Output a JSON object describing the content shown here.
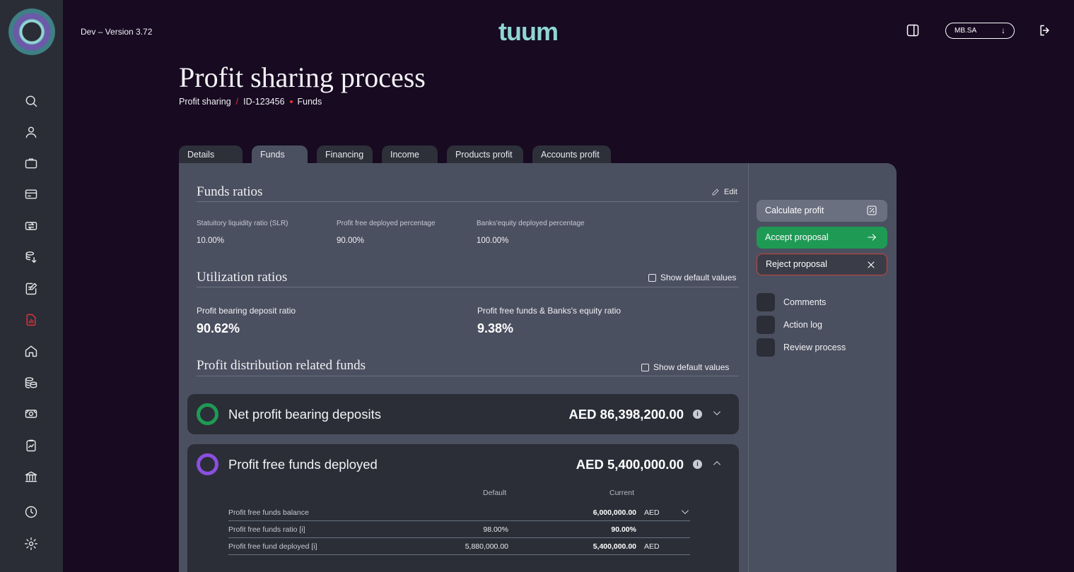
{
  "header": {
    "version": "Dev – Version 3.72",
    "brand": "tuum",
    "org_select": "MB.SA",
    "org_arrow": "↓"
  },
  "sidebar": {
    "items": [
      {
        "icon": "search-icon"
      },
      {
        "icon": "user-icon"
      },
      {
        "icon": "briefcase-icon"
      },
      {
        "icon": "card-icon"
      },
      {
        "icon": "transfer-icon"
      },
      {
        "icon": "coins-transfer-icon"
      },
      {
        "icon": "document-edit-icon"
      },
      {
        "icon": "report-chart-icon",
        "active": true
      },
      {
        "icon": "home-icon"
      },
      {
        "icon": "coins-stack-icon"
      },
      {
        "icon": "cash-icon"
      },
      {
        "icon": "clipboard-chart-icon"
      },
      {
        "icon": "bank-icon"
      },
      {
        "icon": "clock-icon"
      },
      {
        "icon": "settings-icon"
      }
    ]
  },
  "page": {
    "title": "Profit sharing process",
    "breadcrumb": [
      "Profit sharing",
      "ID-123456",
      "Funds"
    ]
  },
  "tabs": [
    {
      "label": "Details"
    },
    {
      "label": "Funds",
      "active": true
    },
    {
      "label": "Financing"
    },
    {
      "label": "Income"
    },
    {
      "label": "Products profit"
    },
    {
      "label": "Accounts profit"
    }
  ],
  "funds_ratios": {
    "title": "Funds ratios",
    "edit_label": "Edit",
    "fields": [
      {
        "label": "Statuitory liquidity ratio (SLR)",
        "value": "10.00%"
      },
      {
        "label": "Profit free deployed percentage",
        "value": "90.00%"
      },
      {
        "label": "Banks'equity deployed percentage",
        "value": "100.00%"
      }
    ]
  },
  "utilization": {
    "title": "Utilization ratios",
    "checkbox_label": "Show default values",
    "ratios": [
      {
        "label": "Profit bearing deposit ratio",
        "value": "90.62%"
      },
      {
        "label": "Profit free funds & Banks's equity ratio",
        "value": "9.38%"
      }
    ]
  },
  "distribution": {
    "title": "Profit distribution related funds",
    "checkbox_label": "Show default values",
    "cards": [
      {
        "name": "Net profit bearing deposits",
        "amount": "AED 86,398,200.00",
        "info": "i",
        "ring_color": "#1e9a54"
      },
      {
        "name": "Profit free funds deployed",
        "amount": "AED 5,400,000.00",
        "info": "i",
        "ring_color": "#8b4fe0"
      }
    ],
    "table": {
      "col_default": "Default",
      "col_current": "Current",
      "rows": [
        {
          "name": "Profit free funds balance",
          "default": "",
          "current": "6,000,000.00",
          "unit": "AED"
        },
        {
          "name": "Profit free funds ratio [i]",
          "default": "98.00%",
          "current": "90.00%",
          "unit": ""
        },
        {
          "name": "Profit free fund deployed [i]",
          "default": "5,880,000.00",
          "current": "5,400,000.00",
          "unit": "AED"
        }
      ]
    }
  },
  "actions": {
    "calculate": "Calculate profit",
    "accept": "Accept proposal",
    "reject": "Reject proposal"
  },
  "side_links": [
    {
      "label": "Comments"
    },
    {
      "label": "Action log"
    },
    {
      "label": "Review process"
    }
  ],
  "colors": {
    "background": "#170a21",
    "accent": "#8fd6d2",
    "active_nav": "#e0343b",
    "accept": "#1e9a54",
    "reject_border": "#c8443f"
  }
}
